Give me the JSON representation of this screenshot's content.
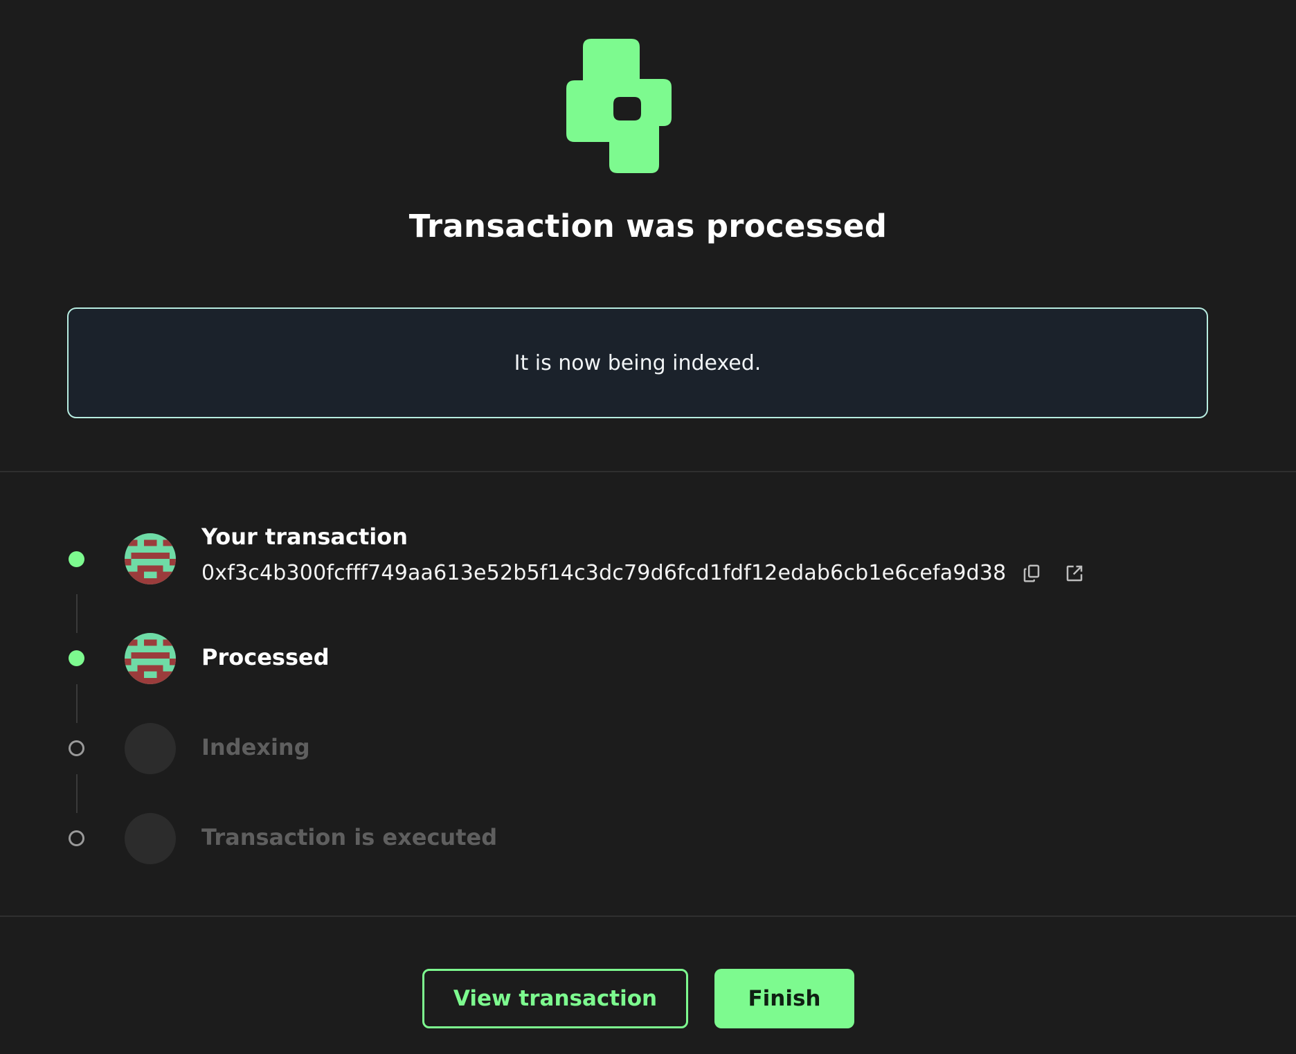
{
  "header": {
    "title": "Transaction was processed",
    "logo_icon": "green-puzzle-logo-icon",
    "accent_color": "#7dfa8f"
  },
  "info_box": {
    "message": "It is now being indexed."
  },
  "steps": [
    {
      "label": "Your transaction",
      "status": "done",
      "hash": "0xf3c4b300fcfff749aa613e52b5f14c3dc79d6fcd1fdf12edab6cb1e6cefa9d38",
      "icons": [
        "copy-icon",
        "external-link-icon"
      ]
    },
    {
      "label": "Processed",
      "status": "done"
    },
    {
      "label": "Indexing",
      "status": "pending"
    },
    {
      "label": "Transaction is executed",
      "status": "pending"
    }
  ],
  "actions": {
    "view_label": "View transaction",
    "finish_label": "Finish"
  }
}
